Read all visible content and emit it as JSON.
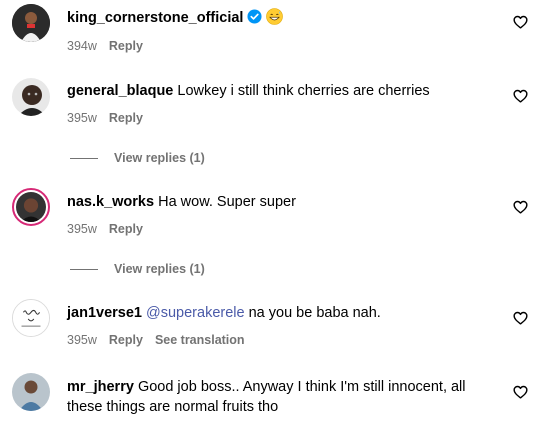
{
  "comments": [
    {
      "username": "king_cornerstone_official",
      "text": "",
      "verified": true,
      "emoji": "grinning-sweat-emoji",
      "time": "394w",
      "reply_label": "Reply"
    },
    {
      "username": "general_blaque",
      "text": "Lowkey i still think cherries are cherries",
      "time": "395w",
      "reply_label": "Reply",
      "view_replies": "View replies (1)"
    },
    {
      "username": "nas.k_works",
      "text": "Ha wow. Super super",
      "time": "395w",
      "reply_label": "Reply",
      "view_replies": "View replies (1)"
    },
    {
      "username": "jan1verse1",
      "mention": "@superakerele",
      "text": "na you be baba nah.",
      "time": "395w",
      "reply_label": "Reply",
      "translation_label": "See translation"
    },
    {
      "username": "mr_jherry",
      "text": "Good job boss.. Anyway I think I'm still innocent, all these things are normal fruits tho"
    }
  ],
  "colors": {
    "meta": "#737373",
    "mention": "#4a5aa8",
    "verified": "#0095f6"
  }
}
